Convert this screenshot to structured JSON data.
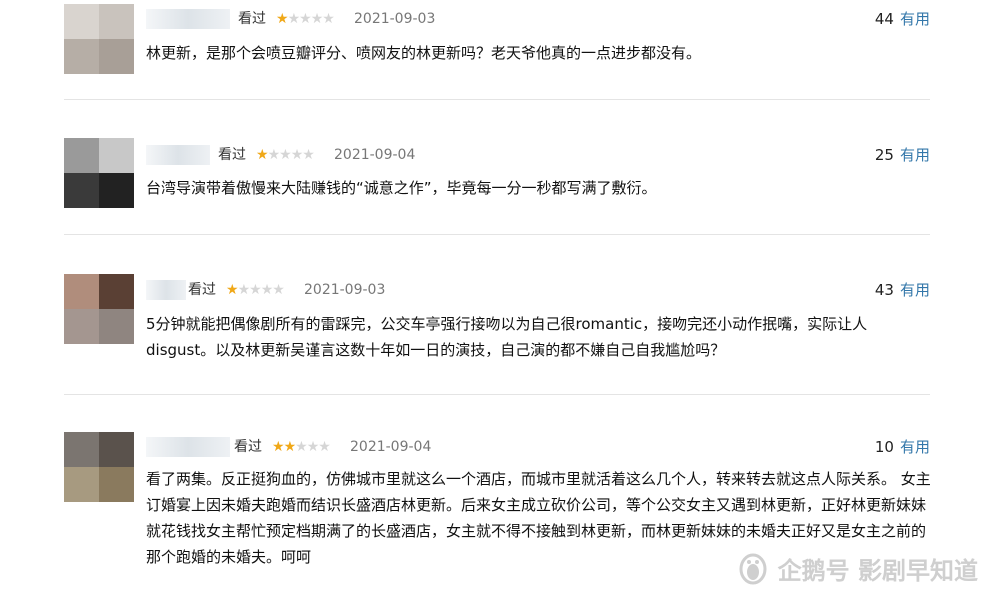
{
  "reviews": [
    {
      "status": "看过",
      "rating": 1,
      "rating_max": 5,
      "date": "2021-09-03",
      "votes": "44",
      "useful_label": "有用",
      "text": "林更新，是那个会喷豆瓣评分、喷网友的林更新吗？老天爷他真的一点进步都没有。",
      "avatar_colors": [
        "#d9d4cf",
        "#c9c3bd",
        "#b6aea6",
        "#a89f97"
      ]
    },
    {
      "status": "看过",
      "rating": 1,
      "rating_max": 5,
      "date": "2021-09-04",
      "votes": "25",
      "useful_label": "有用",
      "text": "台湾导演带着傲慢来大陆赚钱的“诚意之作”，毕竟每一分一秒都写满了敷衍。",
      "avatar_colors": [
        "#9a9a9a",
        "#c8c8c8",
        "#3a3a3a",
        "#222222"
      ]
    },
    {
      "status": "看过",
      "rating": 1,
      "rating_max": 5,
      "date": "2021-09-03",
      "votes": "43",
      "useful_label": "有用",
      "text": "5分钟就能把偶像剧所有的雷踩完，公交车亭强行接吻以为自己很romantic，接吻完还小动作抿嘴，实际让人disgust。以及林更新吴谨言这数十年如一日的演技，自己演的都不嫌自己自我尴尬吗？",
      "avatar_colors": [
        "#b08d7c",
        "#5a4034",
        "#a49690",
        "#8f8580"
      ]
    },
    {
      "status": "看过",
      "rating": 2,
      "rating_max": 5,
      "date": "2021-09-04",
      "votes": "10",
      "useful_label": "有用",
      "text": "看了两集。反正挺狗血的，仿佛城市里就这么一个酒店，而城市里就活着这么几个人，转来转去就这点人际关系。 女主订婚宴上因未婚夫跑婚而结识长盛酒店林更新。后来女主成立砍价公司，等个公交女主又遇到林更新，正好林更新妹妹就花钱找女主帮忙预定档期满了的长盛酒店，女主就不得不接触到林更新，而林更新妹妹的未婚夫正好又是女主之前的那个跑婚的未婚夫。呵呵",
      "avatar_colors": [
        "#7b7570",
        "#5a524c",
        "#a79a80",
        "#8a7a5e"
      ]
    }
  ],
  "watermark": {
    "text": "企鹅号 影剧早知道",
    "icon": "penguin-logo-icon"
  },
  "colors": {
    "star_on": "#f0a818",
    "star_off": "#d6d6d6",
    "useful": "#3377aa"
  }
}
